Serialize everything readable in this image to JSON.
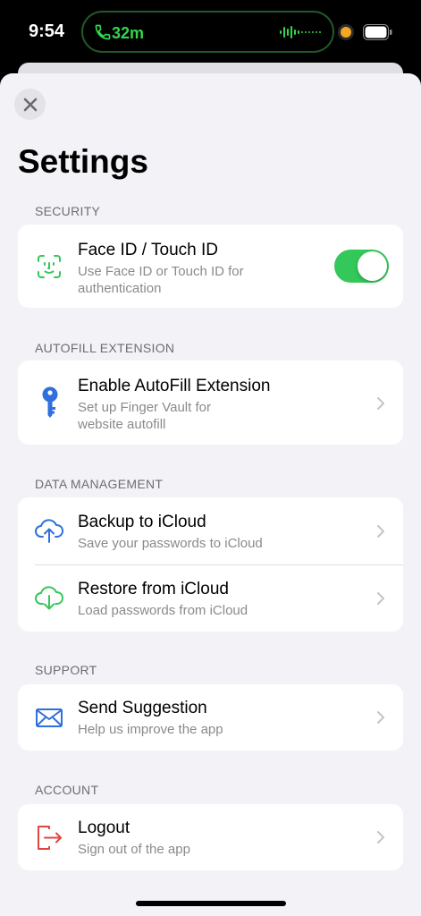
{
  "status_bar": {
    "time": "9:54",
    "call_duration": "32m"
  },
  "page_title": "Settings",
  "colors": {
    "accent_green": "#34c759",
    "blue": "#2f6fde",
    "red": "#e0463c"
  },
  "sections": [
    {
      "header": "SECURITY",
      "rows": [
        {
          "icon": "face-id-icon",
          "title": "Face ID / Touch ID",
          "subtitle": "Use Face ID or Touch ID for authentication",
          "subtitle_line1": "Use Face ID or Touch ID for",
          "subtitle_line2": "authentication",
          "toggle_on": true
        }
      ]
    },
    {
      "header": "AUTOFILL EXTENSION",
      "rows": [
        {
          "icon": "key-icon",
          "title": "Enable AutoFill Extension",
          "subtitle_line1": "Set up Finger Vault for",
          "subtitle_line2": "website autofill"
        }
      ]
    },
    {
      "header": "DATA MANAGEMENT",
      "rows": [
        {
          "icon": "cloud-upload-icon",
          "title": "Backup to iCloud",
          "subtitle": "Save your passwords to iCloud"
        },
        {
          "icon": "cloud-download-icon",
          "title": "Restore from iCloud",
          "subtitle": "Load passwords from iCloud"
        }
      ]
    },
    {
      "header": "SUPPORT",
      "rows": [
        {
          "icon": "envelope-icon",
          "title": "Send Suggestion",
          "subtitle": "Help us improve the app"
        }
      ]
    },
    {
      "header": "ACCOUNT",
      "rows": [
        {
          "icon": "logout-icon",
          "title": "Logout",
          "subtitle": "Sign out of the app"
        }
      ]
    }
  ]
}
